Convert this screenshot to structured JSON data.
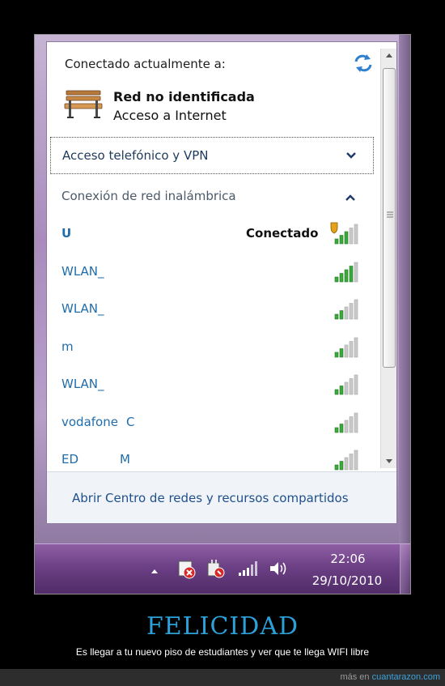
{
  "popup": {
    "status_label": "Conectado actualmente a:",
    "current_network": {
      "name": "Red no identificada",
      "access": "Acceso a Internet",
      "icon": "park-bench-icon"
    },
    "dialup_section": {
      "label": "Acceso telefónico y VPN",
      "expanded": false
    },
    "wireless_section": {
      "label": "Conexión de red inalámbrica",
      "expanded": true
    },
    "networks": [
      {
        "name": "U",
        "extra": "",
        "state": "Conectado",
        "signal_bars": 3,
        "secured_warning": true
      },
      {
        "name": "WLAN_",
        "extra": "",
        "state": "",
        "signal_bars": 4,
        "secured_warning": false
      },
      {
        "name": "WLAN_",
        "extra": "",
        "state": "",
        "signal_bars": 2,
        "secured_warning": false
      },
      {
        "name": "m",
        "extra": "",
        "state": "",
        "signal_bars": 2,
        "secured_warning": false
      },
      {
        "name": "WLAN_",
        "extra": "",
        "state": "",
        "signal_bars": 2,
        "secured_warning": false
      },
      {
        "name": "vodafone",
        "extra": "C",
        "state": "",
        "signal_bars": 2,
        "secured_warning": false
      },
      {
        "name": "ED",
        "extra": "M",
        "state": "",
        "signal_bars": 2,
        "secured_warning": false
      }
    ],
    "footer_link": "Abrir Centro de redes y recursos compartidos"
  },
  "taskbar": {
    "time": "22:06",
    "date": "29/10/2010",
    "tray_icons": [
      "show-hidden-icons-arrow",
      "action-center-flag-icon",
      "power-plug-icon",
      "wireless-signal-icon",
      "speaker-icon"
    ]
  },
  "poster": {
    "title": "FELICIDAD",
    "subtitle": "Es llegar a tu nuevo piso de estudiantes y ver que te llega WIFI libre",
    "credit_prefix": "más en",
    "credit_site": "cuantarazon.com"
  },
  "colors": {
    "link": "#1f6dab",
    "taskbar": "#6b3f84",
    "title": "#2ba1d8",
    "signal_green": "#3aa83a"
  }
}
